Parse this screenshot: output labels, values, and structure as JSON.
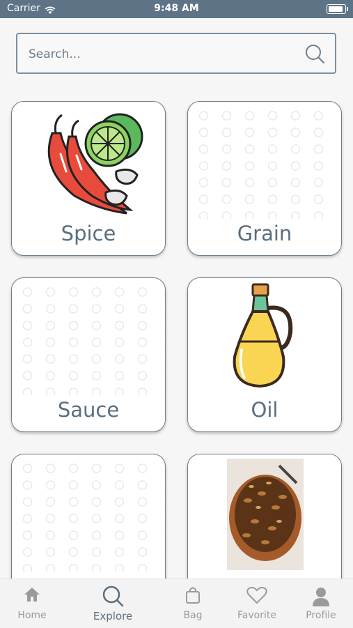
{
  "status": {
    "carrier": "Carrier",
    "time": "9:48 AM"
  },
  "search": {
    "placeholder": "Search..."
  },
  "categories": [
    {
      "label": "Spice",
      "image": "chili-lime-garlic"
    },
    {
      "label": "Grain",
      "image": "placeholder-pattern"
    },
    {
      "label": "Sauce",
      "image": "placeholder-pattern"
    },
    {
      "label": "Oil",
      "image": "oil-bottle"
    },
    {
      "label": "",
      "image": "placeholder-pattern"
    },
    {
      "label": "",
      "image": "nuts-bowl-photo"
    }
  ],
  "tabs": [
    {
      "label": "Home",
      "icon": "home-icon"
    },
    {
      "label": "Explore",
      "icon": "search-icon",
      "active": true
    },
    {
      "label": "Bag",
      "icon": "bag-icon"
    },
    {
      "label": "Favorite",
      "icon": "heart-icon"
    },
    {
      "label": "Profile",
      "icon": "person-icon"
    }
  ],
  "colors": {
    "accent": "#5a6e7e",
    "statusbar": "#5e7486",
    "inactive": "#9a9a9a"
  }
}
